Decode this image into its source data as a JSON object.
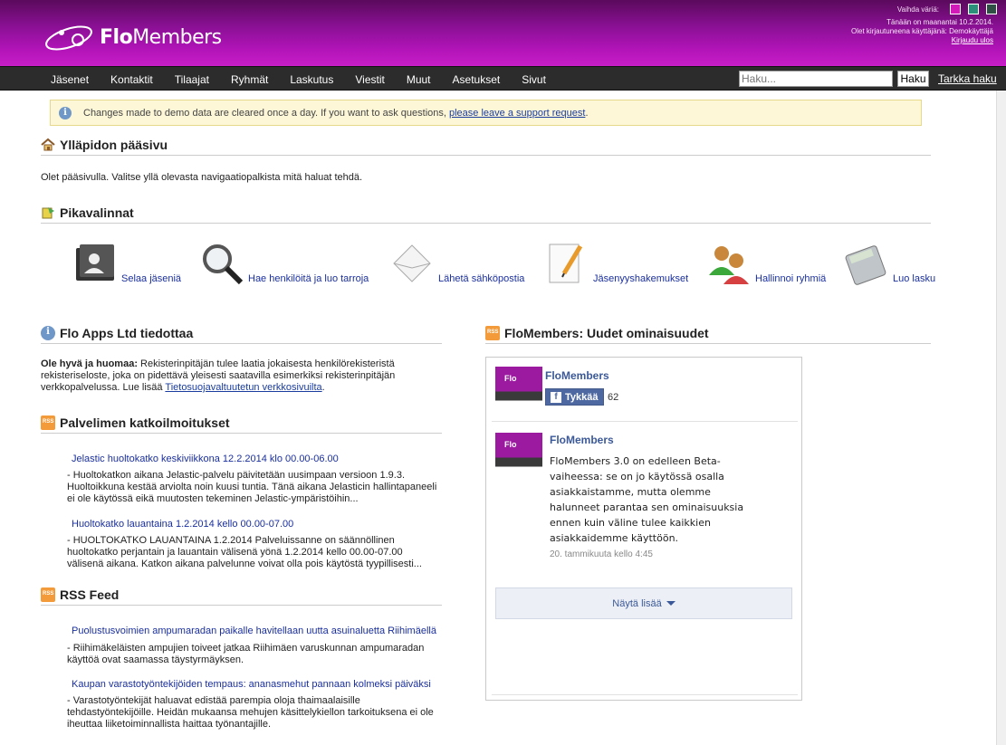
{
  "header": {
    "logo_text_bold": "Flo",
    "logo_text_light": "Members",
    "color_label": "Vaihda väriä:",
    "color_swatches": [
      "#d11ab8",
      "#2c8f7a",
      "#2f4f44"
    ],
    "date_line": "Tänään on maanantai 10.2.2014.",
    "user_line": "Olet kirjautuneena käyttäjänä: Demokäyttäjä",
    "logout_label": "Kirjaudu ulos"
  },
  "nav": {
    "items": [
      "Jäsenet",
      "Kontaktit",
      "Tilaajat",
      "Ryhmät",
      "Laskutus",
      "Viestit",
      "Muut",
      "Asetukset",
      "Sivut"
    ],
    "search_placeholder": "Haku...",
    "search_button": "Haku",
    "advanced_search": "Tarkka haku"
  },
  "notice": {
    "text": "Changes made to demo data are cleared once a day. If you want to ask questions, ",
    "link": "please leave a support request",
    "end": "."
  },
  "main": {
    "title": "Ylläpidon pääsivu",
    "intro": "Olet pääsivulla. Valitse yllä olevasta navigaatiopalkista mitä haluat tehdä."
  },
  "quick": {
    "title": "Pikavalinnat",
    "items": [
      "Selaa jäseniä",
      "Hae henkilöitä ja luo tarroja",
      "Lähetä sähköpostia",
      "Jäsenyyshakemukset",
      "Hallinnoi ryhmiä",
      "Luo lasku"
    ]
  },
  "announcements": {
    "title": "Flo Apps Ltd tiedottaa",
    "bold": "Ole hyvä ja huomaa:",
    "text": " Rekisterinpitäjän tulee laatia jokaisesta henkilörekisteristä rekisteriseloste, joka on pidettävä yleisesti saatavilla esimerkiksi rekisterinpitäjän verkkopalvelussa. Lue lisää ",
    "link": "Tietosuojavaltuutetun verkkosivuilta",
    "end": "."
  },
  "outages": {
    "title": "Palvelimen katkoilmoitukset",
    "items": [
      {
        "title": "Jelastic huoltokatko keskiviikkona 12.2.2014 klo 00.00-06.00",
        "body": "- Huoltokatkon aikana Jelastic-palvelu päivitetään uusimpaan versioon 1.9.3. Huoltoikkuna kestää arviolta noin kuusi tuntia. Tänä aikana Jelasticin hallintapaneeli ei ole käytössä eikä muutosten tekeminen Jelastic-ympäristöihin..."
      },
      {
        "title": "Huoltokatko lauantaina 1.2.2014 kello 00.00-07.00",
        "body": "- HUOLTOKATKO LAUANTAINA 1.2.2014 Palveluissanne on säännöllinen huoltokatko perjantain ja lauantain välisenä yönä 1.2.2014 kello 00.00-07.00 välisenä aikana. Katkon aikana palvelunne voivat olla pois käytöstä tyypillisesti..."
      }
    ]
  },
  "rss": {
    "title": "RSS Feed",
    "items": [
      {
        "title": "Puolustusvoimien ampumaradan paikalle havitellaan uutta asuinaluetta Riihimäellä",
        "body": "- Riihimäkeläisten ampujien toiveet jatkaa Riihimäen varuskunnan ampumaradan käyttöä ovat saamassa täystyrmäyksen."
      },
      {
        "title": "Kaupan varastotyöntekijöiden tempaus: ananasmehut pannaan kolmeksi päiväksi",
        "body": "- Varastotyöntekijät haluavat edistää parempia oloja thaimaalaisille tehdastyöntekijöille. Heidän mukaansa mehujen käsittelykiellon tarkoituksena ei ole iheuttaa liiketoiminnallista haittaa työnantajille."
      }
    ]
  },
  "features": {
    "title": "FloMembers: Uudet ominaisuudet",
    "page_name": "FloMembers",
    "like_label": "Tykkää",
    "like_count": "62",
    "post_author": "FloMembers",
    "post_text": "FloMembers 3.0 on edelleen Beta-vaiheessa: se on jo käytössä osalla asiakkaistamme, mutta olemme halunneet parantaa sen ominaisuuksia ennen kuin väline tulee kaikkien asiakkaidemme käyttöön.",
    "post_time": "20. tammikuuta kello 4:45",
    "show_more": "Näytä lisää",
    "thumb_text": "Flo"
  }
}
